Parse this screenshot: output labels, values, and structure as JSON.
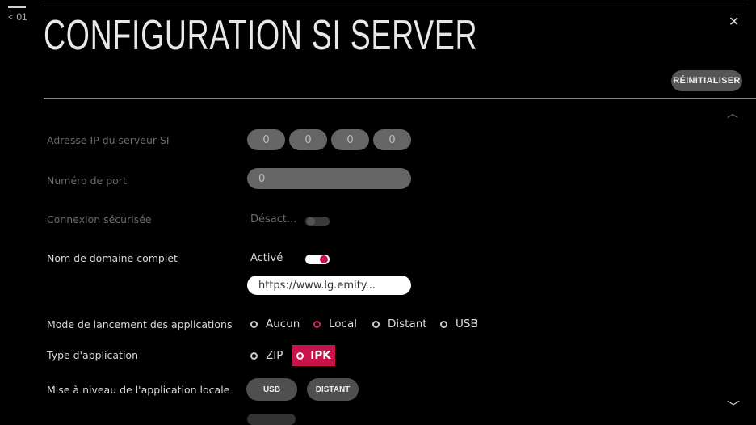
{
  "nav": {
    "back_label": "< 01"
  },
  "header": {
    "title": "CONFIGURATION SI SERVER",
    "reset_label": "RÉINITIALISER"
  },
  "rows": {
    "ip": {
      "label": "Adresse IP du serveur SI",
      "octets": [
        "0",
        "0",
        "0",
        "0"
      ]
    },
    "port": {
      "label": "Numéro de port",
      "value": "0"
    },
    "secure": {
      "label": "Connexion sécurisée",
      "state_text": "Désact...",
      "on": false
    },
    "fqdn": {
      "label": "Nom de domaine complet",
      "state_text": "Activé",
      "on": true,
      "url": "https://www.lg.emity..."
    },
    "launch_mode": {
      "label": "Mode de lancement des applications",
      "options": [
        "Aucun",
        "Local",
        "Distant",
        "USB"
      ],
      "selected": "Local"
    },
    "app_type": {
      "label": "Type d'application",
      "options": [
        "ZIP",
        "IPK"
      ],
      "selected": "IPK"
    },
    "upgrade": {
      "label": "Mise à niveau de l'application locale",
      "buttons": [
        "USB",
        "DISTANT"
      ]
    }
  },
  "colors": {
    "accent": "#c8144b",
    "background": "#000000"
  }
}
